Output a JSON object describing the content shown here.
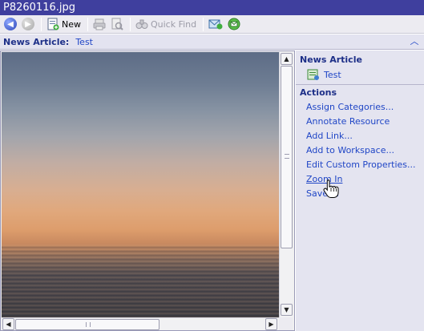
{
  "window": {
    "title": "P8260116.jpg"
  },
  "toolbar": {
    "back_icon": "back-arrow-icon",
    "forward_icon": "forward-arrow-icon",
    "new_label": "New",
    "quick_find_label": "Quick Find"
  },
  "navbar": {
    "label": "News Article:",
    "value": "Test"
  },
  "sidebar": {
    "section1_title": "News Article",
    "section1_item": "Test",
    "section2_title": "Actions",
    "actions": [
      "Assign Categories...",
      "Annotate Resource",
      "Add Link...",
      "Add to Workspace...",
      "Edit Custom Properties...",
      "Zoom In",
      "Save ..."
    ]
  },
  "colors": {
    "title_bg": "#3f3f9e",
    "link": "#2046c6",
    "panel_bg": "#e4e4f0"
  }
}
